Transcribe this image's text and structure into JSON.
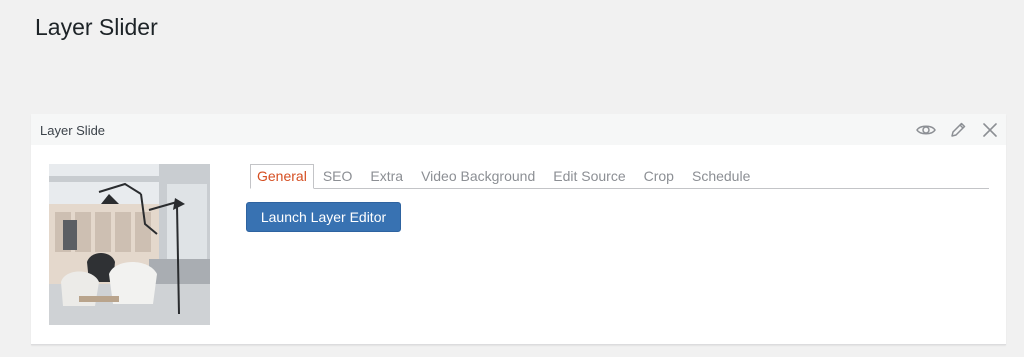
{
  "page": {
    "title": "Layer Slider"
  },
  "panel": {
    "title": "Layer Slide",
    "actions": [
      {
        "name": "eye-icon"
      },
      {
        "name": "pencil-icon"
      },
      {
        "name": "close-icon"
      }
    ]
  },
  "tabs": [
    {
      "label": "General",
      "active": true
    },
    {
      "label": "SEO",
      "active": false
    },
    {
      "label": "Extra",
      "active": false
    },
    {
      "label": "Video Background",
      "active": false
    },
    {
      "label": "Edit Source",
      "active": false
    },
    {
      "label": "Crop",
      "active": false
    },
    {
      "label": "Schedule",
      "active": false
    }
  ],
  "launch_button": {
    "label": "Launch Layer Editor"
  },
  "colors": {
    "accent_blue": "#3872b2",
    "active_tab": "#d54e21",
    "inactive_tab": "#8c8f94",
    "page_bg": "#f1f1f1"
  }
}
